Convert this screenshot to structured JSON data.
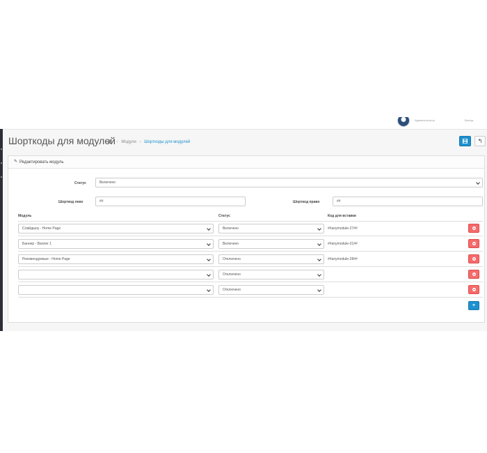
{
  "topbar": {
    "user": "Администратор",
    "logout": "Выход"
  },
  "header": {
    "title": "Шорткоды для модулей",
    "breadcrumb": [
      "Модули",
      "Шорткоды для модулей"
    ],
    "save_icon": "save-icon",
    "back_icon": "reply-icon"
  },
  "panel": {
    "heading": "Редактировать модуль",
    "status_label": "Статус",
    "status_value": "Включено",
    "shortcode_left_label": "Шорткод лево",
    "shortcode_left_value": "##",
    "shortcode_right_label": "Шорткод право",
    "shortcode_right_value": "##"
  },
  "table": {
    "headers": [
      "Модуль",
      "Статус",
      "Код для вставки"
    ],
    "rows": [
      {
        "module": "Слайдшоу - Home Page",
        "status": "Включено",
        "code": "##anymodule-27##"
      },
      {
        "module": "Баннер - Banner 1",
        "status": "Включено",
        "code": "##anymodule-31##"
      },
      {
        "module": "Рекомендуемые - Home Page",
        "status": "Отключено",
        "code": "##anymodule-28##"
      },
      {
        "module": "",
        "status": "Отключено",
        "code": ""
      },
      {
        "module": "",
        "status": "Отключено",
        "code": ""
      }
    ],
    "add_label": "+"
  },
  "colors": {
    "primary": "#1e91cf",
    "danger": "#f56b6b",
    "sidebar": "#2b2f35"
  }
}
